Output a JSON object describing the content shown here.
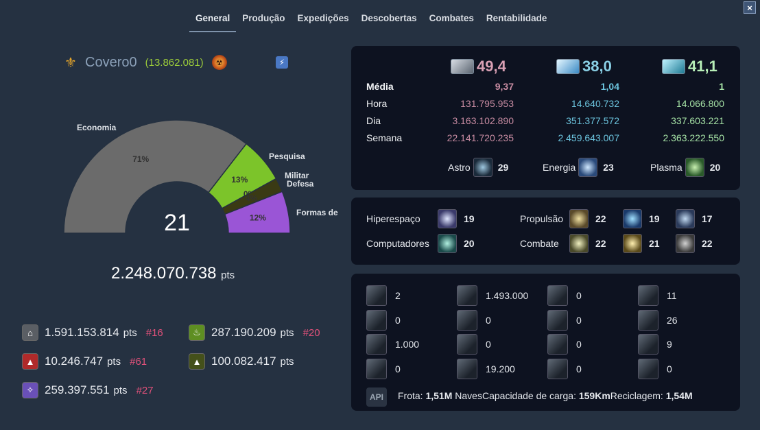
{
  "tabs": [
    {
      "label": "General",
      "active": true
    },
    {
      "label": "Produção"
    },
    {
      "label": "Expedições"
    },
    {
      "label": "Descobertas"
    },
    {
      "label": "Combates"
    },
    {
      "label": "Rentabilidade"
    }
  ],
  "close_label": "×",
  "player": {
    "name": "Covero0",
    "points_paren": "(13.862.081)",
    "wings_icon": "wings-icon",
    "alliance_icon": "alliance-emblem-icon",
    "action_icon": "lightning-icon"
  },
  "chart_data": {
    "type": "pie",
    "variant": "semi-donut",
    "center_value": "21",
    "slices": [
      {
        "name": "Economia",
        "percent": 71,
        "label": "71%",
        "color": "#6b6b6b"
      },
      {
        "name": "Pesquisa",
        "percent": 13,
        "label": "13%",
        "color": "#7cc42a"
      },
      {
        "name": "Militar",
        "percent": 0,
        "label": "0%",
        "color": "#3a3a14"
      },
      {
        "name": "Defesa",
        "percent": 4,
        "label": "4%",
        "color": "#3a3a14"
      },
      {
        "name": "Formas de",
        "percent": 12,
        "label": "12%",
        "color": "#9a55d6"
      }
    ]
  },
  "total": {
    "value": "2.248.070.738",
    "unit": "pts"
  },
  "categories": [
    {
      "icon": "economy-icon",
      "value": "1.591.153.814",
      "unit": "pts",
      "rank": "#16"
    },
    {
      "icon": "research-icon",
      "value": "287.190.209",
      "unit": "pts",
      "rank": "#20"
    },
    {
      "icon": "military-icon",
      "value": "10.246.747",
      "unit": "pts",
      "rank": "#61"
    },
    {
      "icon": "defense-icon",
      "value": "100.082.417",
      "unit": "pts",
      "rank": ""
    },
    {
      "icon": "lifeform-icon",
      "value": "259.397.551",
      "unit": "pts",
      "rank": "#27"
    }
  ],
  "resources": {
    "headers": [
      {
        "icon": "metal-icon",
        "value": "49,4"
      },
      {
        "icon": "crystal-icon",
        "value": "38,0"
      },
      {
        "icon": "deuterium-icon",
        "value": "41,1"
      }
    ],
    "rows": [
      {
        "label": "Média",
        "values": [
          "9,37",
          "1,04",
          "1"
        ]
      },
      {
        "label": "Hora",
        "values": [
          "131.795.953",
          "14.640.732",
          "14.066.800"
        ]
      },
      {
        "label": "Dia",
        "values": [
          "3.163.102.890",
          "351.377.572",
          "337.603.221"
        ]
      },
      {
        "label": "Semana",
        "values": [
          "22.141.720.235",
          "2.459.643.007",
          "2.363.222.550"
        ]
      }
    ],
    "classes": [
      {
        "label": "Astro",
        "icon": "astrophysics-icon",
        "value": "29"
      },
      {
        "label": "Energia",
        "icon": "energy-tech-icon",
        "value": "23"
      },
      {
        "label": "Plasma",
        "icon": "plasma-tech-icon",
        "value": "20"
      }
    ]
  },
  "techs": [
    {
      "label": "Hiperespaço",
      "icon": "hyperspace-tech-icon",
      "value": "19"
    },
    {
      "label": "Propulsão",
      "icon": "combustion-drive-icon",
      "value": "22"
    },
    {
      "label": "",
      "icon": "impulse-drive-icon",
      "value": "19"
    },
    {
      "label": "",
      "icon": "hyperspace-drive-icon",
      "value": "17"
    },
    {
      "label": "Computadores",
      "icon": "computer-tech-icon",
      "value": "20"
    },
    {
      "label": "Combate",
      "icon": "weapons-tech-icon",
      "value": "22"
    },
    {
      "label": "",
      "icon": "shielding-tech-icon",
      "value": "21"
    },
    {
      "label": "",
      "icon": "armour-tech-icon",
      "value": "22"
    }
  ],
  "ships": [
    {
      "icon": "light-fighter-icon",
      "value": "2"
    },
    {
      "icon": "heavy-fighter-icon",
      "value": "1.493.000"
    },
    {
      "icon": "cruiser-icon",
      "value": "0"
    },
    {
      "icon": "battleship-icon",
      "value": "11"
    },
    {
      "icon": "battlecruiser-icon",
      "value": "0"
    },
    {
      "icon": "bomber-icon",
      "value": "0"
    },
    {
      "icon": "destroyer-icon",
      "value": "0"
    },
    {
      "icon": "deathstar-icon",
      "value": "26"
    },
    {
      "icon": "small-cargo-icon",
      "value": "1.000"
    },
    {
      "icon": "large-cargo-icon",
      "value": "0"
    },
    {
      "icon": "colony-ship-icon",
      "value": "0"
    },
    {
      "icon": "recycler-icon",
      "value": "9"
    },
    {
      "icon": "espionage-probe-icon",
      "value": "0"
    },
    {
      "icon": "reaper-icon",
      "value": "19.200"
    },
    {
      "icon": "pathfinder-icon",
      "value": "0"
    },
    {
      "icon": "crawler-icon",
      "value": "0"
    }
  ],
  "footer": {
    "api_label": "API",
    "frota_label": "Frota:",
    "frota_value": "1,51M",
    "naves_label": "Naves",
    "carga_label": "Capacidade de carga:",
    "carga_value": "159Km",
    "reciclagem_label": "Reciclagem:",
    "reciclagem_value": "1,54M"
  },
  "colors": {
    "background": "#253141",
    "panel": "#0d1220",
    "metal": "#c88ca2",
    "crystal": "#6cc4de",
    "deuterium": "#a6e3a6",
    "rank": "#e0517a",
    "player_points": "#9ccc3a"
  }
}
